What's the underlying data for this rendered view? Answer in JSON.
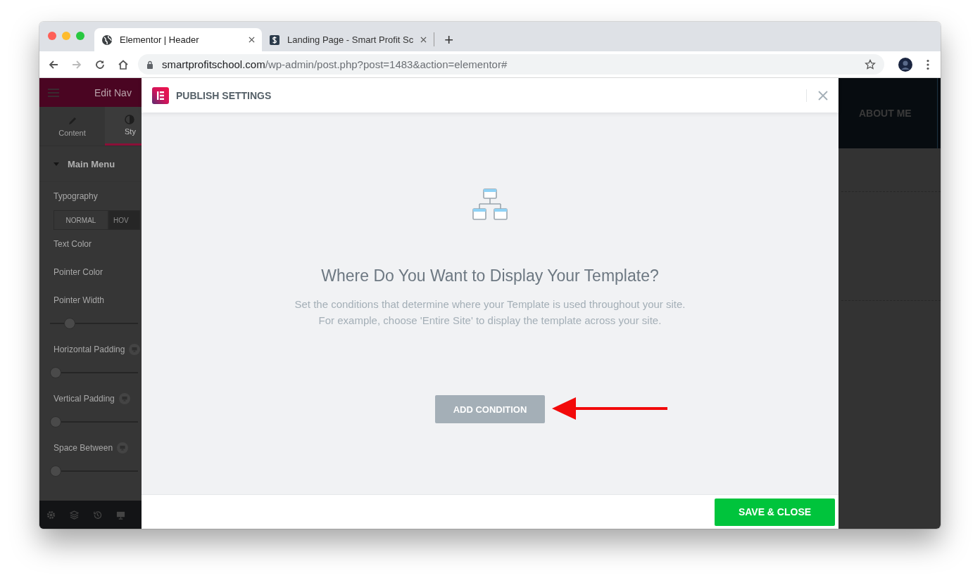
{
  "browser": {
    "tabs": [
      {
        "label": "Elementor | Header",
        "selected": true
      },
      {
        "label": "Landing Page - Smart Profit Sc",
        "selected": false
      }
    ],
    "new_tab": "+",
    "url": {
      "domain": "smartprofitschool.com",
      "path": "/wp-admin/post.php?post=1483&action=elementor#"
    }
  },
  "editor_panel": {
    "title": "Edit Nav",
    "tabs": [
      {
        "label": "Content",
        "selected": false
      },
      {
        "label": "Sty",
        "selected": true
      }
    ],
    "section": "Main Menu",
    "controls": [
      {
        "kind": "label",
        "label": "Typography"
      },
      {
        "kind": "toggle",
        "options": [
          {
            "label": "NORMAL",
            "selected": false
          },
          {
            "label": "HOV",
            "selected": true
          }
        ]
      },
      {
        "kind": "label",
        "label": "Text Color"
      },
      {
        "kind": "label",
        "label": "Pointer Color"
      },
      {
        "kind": "label",
        "label": "Pointer Width"
      },
      {
        "kind": "slider",
        "level": 0.18
      },
      {
        "kind": "responsive_label",
        "label": "Horizontal Padding"
      },
      {
        "kind": "slider",
        "level": 0
      },
      {
        "kind": "responsive_label",
        "label": "Vertical Padding"
      },
      {
        "kind": "slider",
        "level": 0
      },
      {
        "kind": "responsive_label",
        "label": "Space Between"
      },
      {
        "kind": "slider",
        "level": 0
      }
    ]
  },
  "modal": {
    "title": "PUBLISH SETTINGS",
    "heading": "Where Do You Want to Display Your Template?",
    "description": [
      "Set the conditions that determine where your Template is used throughout your site.",
      "For example, choose 'Entire Site' to display the template across your site."
    ],
    "add_button": "ADD CONDITION",
    "save_button": "SAVE & CLOSE"
  },
  "preview": {
    "nav_item": "ABOUT ME"
  }
}
